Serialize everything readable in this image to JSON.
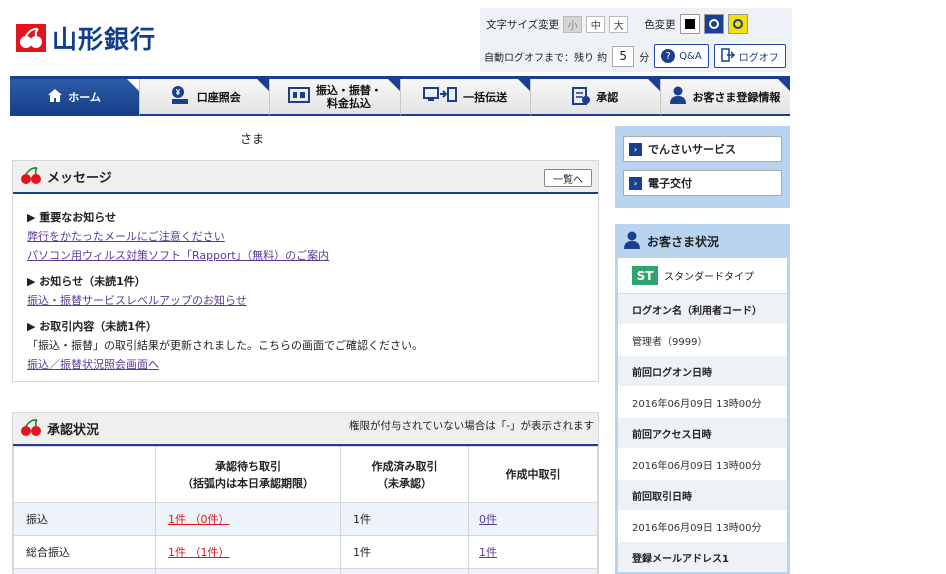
{
  "brand": {
    "name": "山形銀行",
    "color": "#123e8c",
    "accent": "#e0161c"
  },
  "tools": {
    "font_size_label": "文字サイズ変更",
    "font_sizes": [
      "小",
      "中",
      "大"
    ],
    "color_label": "色変更",
    "auto_logoff_label": "自動ログオフまで：残り 約",
    "auto_logoff_value": "5",
    "auto_logoff_unit": "分",
    "qa_label": "Q&A",
    "logoff_label": "ログオフ"
  },
  "nav": {
    "home": "ホーム",
    "account": "口座照会",
    "transfer_line1": "振込・振替・",
    "transfer_line2": "料金払込",
    "bulk": "一括伝送",
    "approve": "承認",
    "customer": "お客さま登録情報"
  },
  "greeting": "さま",
  "message": {
    "title": "メッセージ",
    "list_button": "一覧へ",
    "important_title": "▶ 重要なお知らせ",
    "important_links": [
      "弊行をかたったメールにご注意ください",
      "パソコン用ウィルス対策ソフト「Rapport」（無料）のご案内"
    ],
    "notice_title": "▶ お知らせ（未読1件）",
    "notice_link": "振込・振替サービスレベルアップのお知らせ",
    "trans_title": "▶ お取引内容（未読1件）",
    "trans_text": "「振込・振替」の取引結果が更新されました。こちらの画面でご確認ください。",
    "trans_link": "振込／振替状況照会画面へ"
  },
  "approval": {
    "title": "承認状況",
    "note": "権限が付与されていない場合は「-」が表示されます",
    "headers": [
      {
        "line1": "承認待ち取引",
        "line2": "（括弧内は本日承認期限）"
      },
      {
        "line1": "作成済み取引",
        "line2": "（未承認）"
      },
      {
        "line1": "作成中取引",
        "line2": ""
      }
    ],
    "rows": [
      {
        "label": "振込",
        "pending": "1件 （0件）",
        "created": "1件",
        "draft": "0件"
      },
      {
        "label": "総合振込",
        "pending": "1件 （1件）",
        "created": "1件",
        "draft": "1件"
      }
    ]
  },
  "side": {
    "links": [
      "でんさいサービス",
      "電子交付"
    ],
    "status_title": "お客さま状況",
    "plan_badge": "ST",
    "plan_name": "スタンダードタイプ",
    "logon_name_label": "ログオン名（利用者コード）",
    "logon_name_value": "管理者（9999）",
    "last_logon_label": "前回ログオン日時",
    "last_logon_value": "2016年06月09日 13時00分",
    "last_access_label": "前回アクセス日時",
    "last_access_value": "2016年06月09日 13時00分",
    "last_trans_label": "前回取引日時",
    "last_trans_value": "2016年06月09日 13時00分",
    "email_label": "登録メールアドレス1"
  }
}
